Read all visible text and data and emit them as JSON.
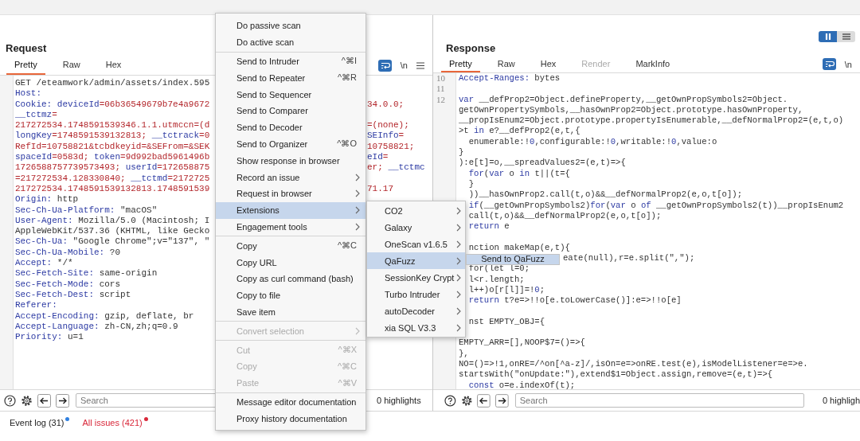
{
  "request": {
    "title": "Request",
    "tabs": [
      {
        "label": "Pretty",
        "selected": true
      },
      {
        "label": "Raw",
        "selected": false
      },
      {
        "label": "Hex",
        "selected": false
      }
    ],
    "newline_toggle": "\\n",
    "lines": [
      {
        "segs": [
          {
            "kind": "text",
            "t": "GET /eteamwork/admin/assets/index.595"
          }
        ]
      },
      {
        "segs": [
          {
            "kind": "name",
            "t": "Host:"
          }
        ]
      },
      {
        "segs": [
          {
            "kind": "name",
            "t": "Cookie: deviceId"
          },
          {
            "kind": "cookie",
            "t": "=06b36549679b7e4a9672"
          }
        ],
        "tail": [
          {
            "kind": "cookie",
            "t": "34.0.0;"
          }
        ]
      },
      {
        "segs": [
          {
            "kind": "name",
            "t": "__tctmz"
          },
          {
            "kind": "cookie",
            "t": "="
          }
        ]
      },
      {
        "segs": [
          {
            "kind": "cookie",
            "t": "217272534.1748591539346.1.1.utmccn=(d"
          }
        ],
        "tail": [
          {
            "kind": "cookie",
            "t": "=(none);"
          }
        ]
      },
      {
        "segs": [
          {
            "kind": "name",
            "t": "longKey"
          },
          {
            "kind": "cookie",
            "t": "=1748591539132813;"
          },
          {
            "kind": "name",
            "t": " __tctrack"
          },
          {
            "kind": "cookie",
            "t": "=0"
          }
        ],
        "tail": [
          {
            "kind": "name",
            "t": "SEInfo"
          },
          {
            "kind": "cookie",
            "t": "="
          }
        ]
      },
      {
        "segs": [
          {
            "kind": "cookie",
            "t": "RefId=10758821&tcbdkeyid=&SEFrom=&SEK"
          }
        ],
        "tail": [
          {
            "kind": "cookie",
            "t": "10758821;"
          }
        ]
      },
      {
        "segs": [
          {
            "kind": "name",
            "t": "spaceId"
          },
          {
            "kind": "cookie",
            "t": "=0583d;"
          },
          {
            "kind": "name",
            "t": " token"
          },
          {
            "kind": "cookie",
            "t": "=9d992bad5961496b"
          }
        ],
        "tail": [
          {
            "kind": "name",
            "t": "eId"
          },
          {
            "kind": "cookie",
            "t": "="
          }
        ]
      },
      {
        "segs": [
          {
            "kind": "cookie",
            "t": "1726588757739573493;"
          },
          {
            "kind": "name",
            "t": " userId"
          },
          {
            "kind": "cookie",
            "t": "=172658875"
          }
        ],
        "tail": [
          {
            "kind": "cookie",
            "t": "er;"
          },
          {
            "kind": "name",
            "t": " __tctmc"
          }
        ]
      },
      {
        "segs": [
          {
            "kind": "cookie",
            "t": "=217272534.128330840;"
          },
          {
            "kind": "name",
            "t": " __tctmd"
          },
          {
            "kind": "cookie",
            "t": "=2172725"
          }
        ]
      },
      {
        "segs": [
          {
            "kind": "cookie",
            "t": "217272534.1748591539132813.1748591539"
          }
        ],
        "tail": [
          {
            "kind": "cookie",
            "t": "71.17"
          }
        ]
      },
      {
        "segs": [
          {
            "kind": "name",
            "t": "Origin:"
          },
          {
            "kind": "text",
            "t": " http"
          }
        ]
      },
      {
        "segs": [
          {
            "kind": "name",
            "t": "Sec-Ch-Ua-Platform:"
          },
          {
            "kind": "text",
            "t": " \"macOS\""
          }
        ]
      },
      {
        "segs": [
          {
            "kind": "name",
            "t": "User-Agent:"
          },
          {
            "kind": "text",
            "t": " Mozilla/5.0 (Macintosh; I"
          }
        ]
      },
      {
        "segs": [
          {
            "kind": "text",
            "t": "AppleWebKit/537.36 (KHTML, like Gecko"
          }
        ]
      },
      {
        "segs": [
          {
            "kind": "name",
            "t": "Sec-Ch-Ua:"
          },
          {
            "kind": "text",
            "t": " \"Google Chrome\";v=\"137\", \""
          }
        ]
      },
      {
        "segs": [
          {
            "kind": "name",
            "t": "Sec-Ch-Ua-Mobile:"
          },
          {
            "kind": "text",
            "t": " ?0"
          }
        ]
      },
      {
        "segs": [
          {
            "kind": "name",
            "t": "Accept:"
          },
          {
            "kind": "text",
            "t": " */*"
          }
        ]
      },
      {
        "segs": [
          {
            "kind": "name",
            "t": "Sec-Fetch-Site:"
          },
          {
            "kind": "text",
            "t": " same-origin"
          }
        ]
      },
      {
        "segs": [
          {
            "kind": "name",
            "t": "Sec-Fetch-Mode:"
          },
          {
            "kind": "text",
            "t": " cors"
          }
        ]
      },
      {
        "segs": [
          {
            "kind": "name",
            "t": "Sec-Fetch-Dest:"
          },
          {
            "kind": "text",
            "t": " script"
          }
        ]
      },
      {
        "segs": [
          {
            "kind": "name",
            "t": "Referer:"
          }
        ]
      },
      {
        "segs": [
          {
            "kind": "name",
            "t": "Accept-Encoding:"
          },
          {
            "kind": "text",
            "t": " gzip, deflate, br"
          }
        ]
      },
      {
        "segs": [
          {
            "kind": "name",
            "t": "Accept-Language:"
          },
          {
            "kind": "text",
            "t": " zh-CN,zh;q=0.9"
          }
        ]
      },
      {
        "segs": [
          {
            "kind": "name",
            "t": "Priority:"
          },
          {
            "kind": "text",
            "t": " u=1"
          }
        ]
      }
    ],
    "search": {
      "placeholder": "Search"
    },
    "highlights": "0 highlights"
  },
  "response": {
    "title": "Response",
    "layout_toggle": [
      {
        "selected": true
      },
      {
        "selected": false
      }
    ],
    "tabs": [
      {
        "label": "Pretty",
        "selected": true,
        "disabled": false
      },
      {
        "label": "Raw",
        "selected": false,
        "disabled": false
      },
      {
        "label": "Hex",
        "selected": false,
        "disabled": false
      },
      {
        "label": "Render",
        "selected": false,
        "disabled": true
      },
      {
        "label": "MarkInfo",
        "selected": false,
        "disabled": false
      }
    ],
    "newline_toggle": "\\n",
    "lines": [
      {
        "kind": "code",
        "number": "10",
        "segs": [
          {
            "kind": "name",
            "t": "Accept-Ranges:"
          },
          {
            "kind": "text",
            "t": " bytes"
          }
        ]
      },
      {
        "kind": "blank",
        "number": "11"
      },
      {
        "kind": "code",
        "number": "12",
        "segs": [
          {
            "kind": "kw",
            "t": "var"
          },
          {
            "kind": "text",
            "t": " __defProp2=Object.defineProperty,__getOwnPropSymbols2=Object."
          }
        ]
      },
      {
        "kind": "code",
        "segs": [
          {
            "kind": "text",
            "t": "getOwnPropertySymbols,__hasOwnProp2=Object.prototype.hasOwnProperty,"
          }
        ]
      },
      {
        "kind": "code",
        "segs": [
          {
            "kind": "text",
            "t": "__propIsEnum2=Object.prototype.propertyIsEnumerable,__defNormalProp2=(e,t,o)"
          }
        ]
      },
      {
        "kind": "code",
        "segs": [
          {
            "kind": "text",
            "t": ">t "
          },
          {
            "kind": "kw",
            "t": "in"
          },
          {
            "kind": "text",
            "t": " e?__defProp2(e,t,{"
          }
        ]
      },
      {
        "kind": "code",
        "segs": [
          {
            "kind": "text",
            "t": "  enumerable:!"
          },
          {
            "kind": "num",
            "t": "0"
          },
          {
            "kind": "text",
            "t": ",configurable:!"
          },
          {
            "kind": "num",
            "t": "0"
          },
          {
            "kind": "text",
            "t": ",writable:!"
          },
          {
            "kind": "num",
            "t": "0"
          },
          {
            "kind": "text",
            "t": ",value:o"
          }
        ]
      },
      {
        "kind": "code",
        "segs": [
          {
            "kind": "text",
            "t": "}"
          }
        ]
      },
      {
        "kind": "code",
        "segs": [
          {
            "kind": "text",
            "t": "):e[t]=o,__spreadValues2=(e,t)=>{"
          }
        ]
      },
      {
        "kind": "code",
        "segs": [
          {
            "kind": "kw",
            "t": "  for"
          },
          {
            "kind": "text",
            "t": "("
          },
          {
            "kind": "kw",
            "t": "var"
          },
          {
            "kind": "text",
            "t": " o "
          },
          {
            "kind": "kw",
            "t": "in"
          },
          {
            "kind": "text",
            "t": " t||(t={"
          }
        ]
      },
      {
        "kind": "code",
        "segs": [
          {
            "kind": "text",
            "t": "  }"
          }
        ]
      },
      {
        "kind": "code",
        "segs": [
          {
            "kind": "text",
            "t": "  ))__hasOwnProp2.call(t,o)&&__defNormalProp2(e,o,t[o]);"
          }
        ]
      },
      {
        "kind": "code",
        "segs": [
          {
            "kind": "kw",
            "t": "  if"
          },
          {
            "kind": "text",
            "t": "(__getOwnPropSymbols2)"
          },
          {
            "kind": "kw",
            "t": "for"
          },
          {
            "kind": "text",
            "t": "("
          },
          {
            "kind": "kw",
            "t": "var"
          },
          {
            "kind": "text",
            "t": " o "
          },
          {
            "kind": "kw",
            "t": "of"
          },
          {
            "kind": "text",
            "t": " __getOwnPropSymbols2(t))__propIsEnum2"
          }
        ]
      },
      {
        "kind": "code",
        "segs": [
          {
            "kind": "text",
            "t": "  call(t,o)&&__defNormalProp2(e,o,t[o]);"
          }
        ]
      },
      {
        "kind": "code",
        "segs": [
          {
            "kind": "kw",
            "t": "  return"
          },
          {
            "kind": "text",
            "t": " e"
          }
        ]
      },
      {
        "kind": "blank"
      },
      {
        "kind": "code",
        "segs": [
          {
            "kind": "text",
            "t": "  nction makeMap(e,t){"
          }
        ]
      },
      {
        "kind": "shifted",
        "segs": [
          {
            "kind": "text",
            "t": "eate(null),r=e.split(\",\");"
          }
        ]
      },
      {
        "kind": "code",
        "segs": [
          {
            "kind": "text",
            "t": "  for(let l=0;"
          }
        ]
      },
      {
        "kind": "code",
        "segs": [
          {
            "kind": "text",
            "t": "  l<r.length;"
          }
        ]
      },
      {
        "kind": "code",
        "segs": [
          {
            "kind": "text",
            "t": "  l++)o[r[l]]=!"
          },
          {
            "kind": "num",
            "t": "0"
          },
          {
            "kind": "text",
            "t": ";"
          }
        ]
      },
      {
        "kind": "code",
        "segs": [
          {
            "kind": "kw",
            "t": "  return"
          },
          {
            "kind": "text",
            "t": " t?e=>!!o[e.toLowerCase()]:e=>!!o[e]"
          }
        ]
      },
      {
        "kind": "blank"
      },
      {
        "kind": "code",
        "segs": [
          {
            "kind": "text",
            "t": "  nst EMPTY_OBJ={"
          }
        ]
      },
      {
        "kind": "blank"
      },
      {
        "kind": "code",
        "segs": [
          {
            "kind": "text",
            "t": "EMPTY_ARR=[],NOOP$7=()=>{"
          }
        ]
      },
      {
        "kind": "code",
        "segs": [
          {
            "kind": "text",
            "t": "},"
          }
        ]
      },
      {
        "kind": "code",
        "segs": [
          {
            "kind": "text",
            "t": "NO=()=>!1,onRE=/^on[^a-z]/,isOn=e=>onRE.test(e),isModelListener=e=>e."
          }
        ]
      },
      {
        "kind": "code",
        "segs": [
          {
            "kind": "text",
            "t": "startsWith(\"onUpdate:\"),extend$1=Object.assign,remove=(e,t)=>{"
          }
        ]
      },
      {
        "kind": "code",
        "segs": [
          {
            "kind": "kw",
            "t": "  const"
          },
          {
            "kind": "text",
            "t": " o=e.indexOf(t);"
          }
        ]
      }
    ],
    "search": {
      "placeholder": "Search"
    },
    "highlights": "0 highligh"
  },
  "menu": {
    "sections": [
      {
        "items": [
          {
            "label": "Do passive scan",
            "submenu": false,
            "disabled": false,
            "selected": false
          },
          {
            "label": "Do active scan",
            "submenu": false,
            "disabled": false,
            "selected": false
          }
        ]
      },
      {
        "items": [
          {
            "label": "Send to Intruder",
            "shortcut": "^⌘I",
            "submenu": false,
            "disabled": false,
            "selected": false
          },
          {
            "label": "Send to Repeater",
            "shortcut": "^⌘R",
            "submenu": false,
            "disabled": false,
            "selected": false
          },
          {
            "label": "Send to Sequencer",
            "submenu": false,
            "disabled": false,
            "selected": false
          },
          {
            "label": "Send to Comparer",
            "submenu": false,
            "disabled": false,
            "selected": false
          },
          {
            "label": "Send to Decoder",
            "submenu": false,
            "disabled": false,
            "selected": false
          },
          {
            "label": "Send to Organizer",
            "shortcut": "^⌘O",
            "submenu": false,
            "disabled": false,
            "selected": false
          },
          {
            "label": "Show response in browser",
            "submenu": false,
            "disabled": false,
            "selected": false
          },
          {
            "label": "Record an issue",
            "submenu": true,
            "disabled": false,
            "selected": false
          },
          {
            "label": "Request in browser",
            "submenu": true,
            "disabled": false,
            "selected": false
          },
          {
            "label": "Extensions",
            "submenu": true,
            "disabled": false,
            "selected": true,
            "children": [
              {
                "label": "CO2",
                "submenu": true,
                "selected": false
              },
              {
                "label": "Galaxy",
                "submenu": true,
                "selected": false
              },
              {
                "label": "OneScan v1.6.5",
                "submenu": true,
                "selected": false
              },
              {
                "label": "QaFuzz",
                "submenu": true,
                "selected": true,
                "children": [
                  {
                    "label": "Send to QaFuzz",
                    "selected": true
                  }
                ]
              },
              {
                "label": "SessionKey Crypt",
                "submenu": true,
                "selected": false
              },
              {
                "label": "Turbo Intruder",
                "submenu": true,
                "selected": false
              },
              {
                "label": "autoDecoder",
                "submenu": true,
                "selected": false
              },
              {
                "label": "xia SQL V3.3",
                "submenu": true,
                "selected": false
              }
            ]
          },
          {
            "label": "Engagement tools",
            "submenu": true,
            "disabled": false,
            "selected": false
          }
        ]
      },
      {
        "items": [
          {
            "label": "Copy",
            "shortcut": "^⌘C",
            "submenu": false,
            "disabled": false,
            "selected": false
          },
          {
            "label": "Copy URL",
            "submenu": false,
            "disabled": false,
            "selected": false
          },
          {
            "label": "Copy as curl command (bash)",
            "submenu": false,
            "disabled": false,
            "selected": false
          },
          {
            "label": "Copy to file",
            "submenu": false,
            "disabled": false,
            "selected": false
          },
          {
            "label": "Save item",
            "submenu": false,
            "disabled": false,
            "selected": false
          }
        ]
      },
      {
        "items": [
          {
            "label": "Convert selection",
            "submenu": true,
            "disabled": true,
            "selected": false
          }
        ]
      },
      {
        "items": [
          {
            "label": "Cut",
            "shortcut": "^⌘X",
            "submenu": false,
            "disabled": true,
            "selected": false
          },
          {
            "label": "Copy",
            "shortcut": "^⌘C",
            "submenu": false,
            "disabled": true,
            "selected": false
          },
          {
            "label": "Paste",
            "shortcut": "^⌘V",
            "submenu": false,
            "disabled": true,
            "selected": false
          }
        ]
      },
      {
        "items": [
          {
            "label": "Message editor documentation",
            "submenu": false,
            "disabled": false,
            "selected": false
          },
          {
            "label": "Proxy history documentation",
            "submenu": false,
            "disabled": false,
            "selected": false
          }
        ]
      }
    ]
  },
  "status_bar": [
    {
      "label": "Event log (31)",
      "color": "#2f80e0",
      "alert": false
    },
    {
      "label": "All issues (421)",
      "color": "#d9283a",
      "alert": true
    }
  ]
}
